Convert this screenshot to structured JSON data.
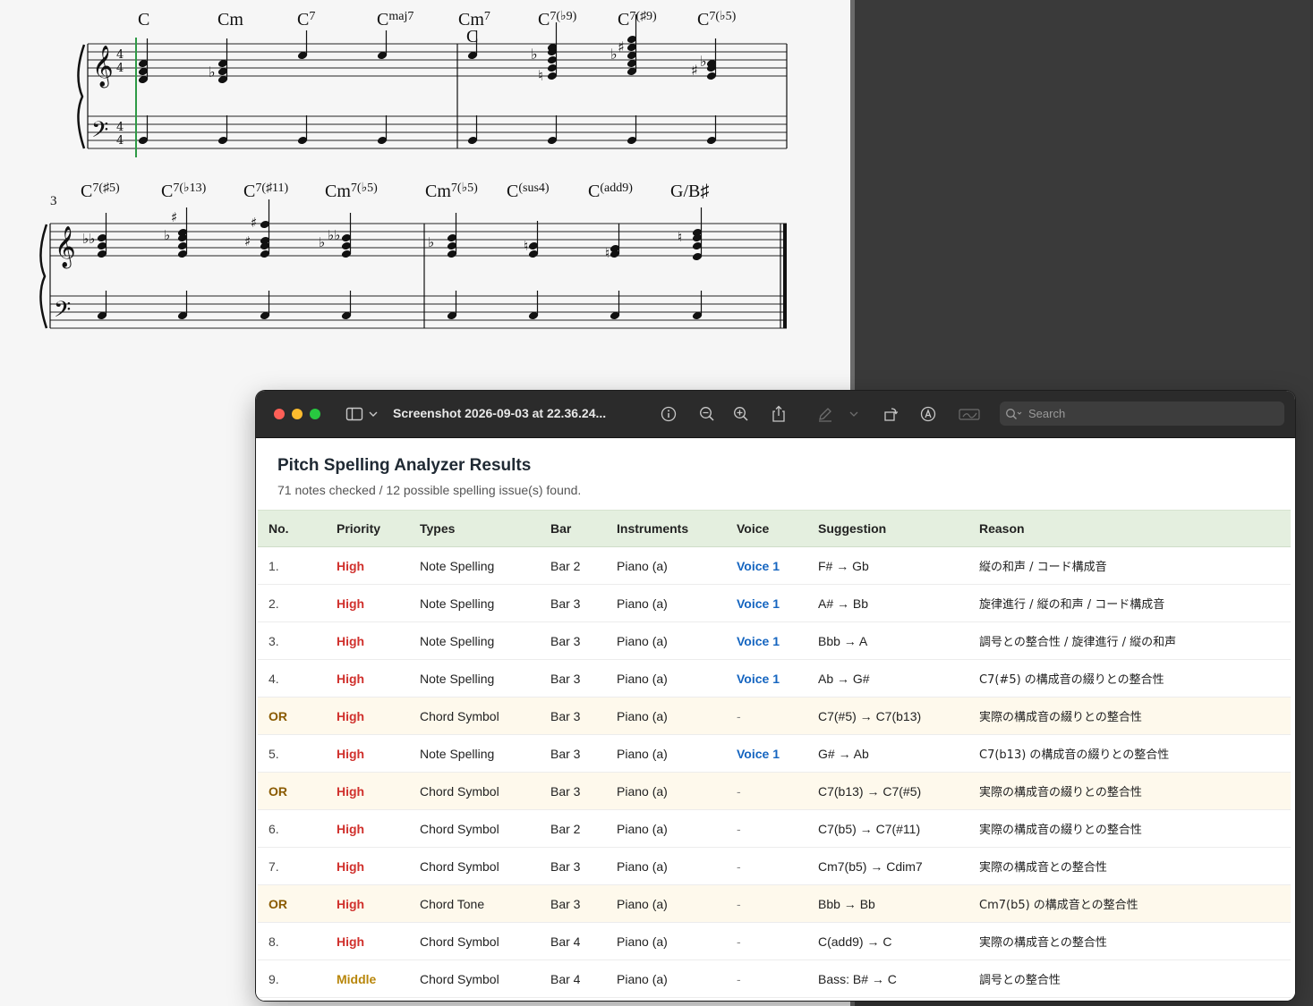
{
  "score": {
    "system1": {
      "chords_bar1": [
        {
          "root": "C",
          "ext": ""
        },
        {
          "root": "Cm",
          "ext": ""
        },
        {
          "root": "C",
          "ext": "7"
        },
        {
          "root": "C",
          "ext": "maj7"
        }
      ],
      "chords_bar2": [
        {
          "root": "Cm",
          "ext": "7"
        },
        {
          "root": "C",
          "ext": "7(♭9)"
        },
        {
          "root": "C",
          "ext": "7(♯9)"
        },
        {
          "root": "C",
          "ext": "7(♭5)"
        }
      ],
      "secondary_symbol": "C"
    },
    "system2": {
      "measure_number": "3",
      "chords_bar3": [
        {
          "root": "C",
          "ext": "7(♯5)"
        },
        {
          "root": "C",
          "ext": "7(♭13)"
        },
        {
          "root": "C",
          "ext": "7(♯11)"
        },
        {
          "root": "Cm",
          "ext": "7(♭5)"
        }
      ],
      "chords_bar4": [
        {
          "root": "Cm",
          "ext": "7(♭5)"
        },
        {
          "root": "C",
          "ext": "(sus4)"
        },
        {
          "root": "C",
          "ext": "(add9)"
        },
        {
          "root": "G/B♯",
          "ext": ""
        }
      ]
    }
  },
  "window": {
    "title": "Screenshot 2026-09-03 at 22.36.24...",
    "search_placeholder": "Search"
  },
  "report": {
    "title": "Pitch Spelling Analyzer Results",
    "subtitle": "71 notes checked / 12 possible spelling issue(s) found.",
    "columns": [
      "No.",
      "Priority",
      "Types",
      "Bar",
      "Instruments",
      "Voice",
      "Suggestion",
      "Reason"
    ],
    "rows": [
      {
        "no": "1.",
        "priority": "High",
        "type": "Note Spelling",
        "bar": "Bar 2",
        "instrument": "Piano (a)",
        "voice": "Voice 1",
        "suggestion": "F# → Gb",
        "reason": "縦の和声 / コード構成音",
        "or": false
      },
      {
        "no": "2.",
        "priority": "High",
        "type": "Note Spelling",
        "bar": "Bar 3",
        "instrument": "Piano (a)",
        "voice": "Voice 1",
        "suggestion": "A# → Bb",
        "reason": "旋律進行 / 縦の和声 / コード構成音",
        "or": false
      },
      {
        "no": "3.",
        "priority": "High",
        "type": "Note Spelling",
        "bar": "Bar 3",
        "instrument": "Piano (a)",
        "voice": "Voice 1",
        "suggestion": "Bbb → A",
        "reason": "調号との整合性 / 旋律進行 / 縦の和声",
        "or": false
      },
      {
        "no": "4.",
        "priority": "High",
        "type": "Note Spelling",
        "bar": "Bar 3",
        "instrument": "Piano (a)",
        "voice": "Voice 1",
        "suggestion": "Ab → G#",
        "reason": "C7(#5) の構成音の綴りとの整合性",
        "or": false
      },
      {
        "no": "OR",
        "priority": "High",
        "type": "Chord Symbol",
        "bar": "Bar 3",
        "instrument": "Piano (a)",
        "voice": "-",
        "suggestion": "C7(#5) → C7(b13)",
        "reason": "実際の構成音の綴りとの整合性",
        "or": true
      },
      {
        "no": "5.",
        "priority": "High",
        "type": "Note Spelling",
        "bar": "Bar 3",
        "instrument": "Piano (a)",
        "voice": "Voice 1",
        "suggestion": "G# → Ab",
        "reason": "C7(b13) の構成音の綴りとの整合性",
        "or": false
      },
      {
        "no": "OR",
        "priority": "High",
        "type": "Chord Symbol",
        "bar": "Bar 3",
        "instrument": "Piano (a)",
        "voice": "-",
        "suggestion": "C7(b13) → C7(#5)",
        "reason": "実際の構成音の綴りとの整合性",
        "or": true
      },
      {
        "no": "6.",
        "priority": "High",
        "type": "Chord Symbol",
        "bar": "Bar 2",
        "instrument": "Piano (a)",
        "voice": "-",
        "suggestion": "C7(b5) → C7(#11)",
        "reason": "実際の構成音の綴りとの整合性",
        "or": false
      },
      {
        "no": "7.",
        "priority": "High",
        "type": "Chord Symbol",
        "bar": "Bar 3",
        "instrument": "Piano (a)",
        "voice": "-",
        "suggestion": "Cm7(b5) → Cdim7",
        "reason": "実際の構成音との整合性",
        "or": false
      },
      {
        "no": "OR",
        "priority": "High",
        "type": "Chord Tone",
        "bar": "Bar 3",
        "instrument": "Piano (a)",
        "voice": "-",
        "suggestion": "Bbb → Bb",
        "reason": "Cm7(b5) の構成音との整合性",
        "or": true
      },
      {
        "no": "8.",
        "priority": "High",
        "type": "Chord Symbol",
        "bar": "Bar 4",
        "instrument": "Piano (a)",
        "voice": "-",
        "suggestion": "C(add9) → C",
        "reason": "実際の構成音との整合性",
        "or": false
      },
      {
        "no": "9.",
        "priority": "Middle",
        "type": "Chord Symbol",
        "bar": "Bar 4",
        "instrument": "Piano (a)",
        "voice": "-",
        "suggestion": "Bass: B# → C",
        "reason": "調号との整合性",
        "or": false
      }
    ]
  }
}
